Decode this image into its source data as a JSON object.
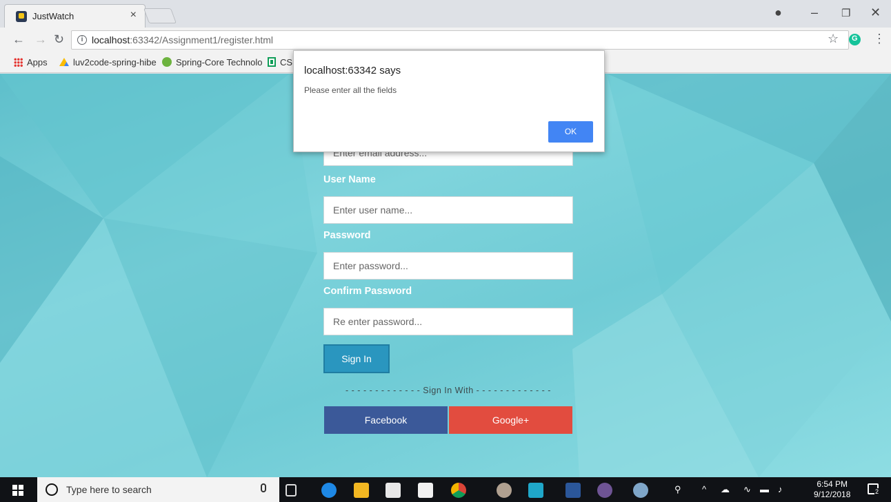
{
  "browser": {
    "tab_title": "JustWatch",
    "tab_close": "×",
    "url_host": "localhost",
    "url_rest": ":63342/Assignment1/register.html",
    "bookmarks": [
      {
        "label": "Apps"
      },
      {
        "label": "luv2code-spring-hibe"
      },
      {
        "label": "Spring-Core Technolo"
      },
      {
        "label": "CS"
      }
    ]
  },
  "form": {
    "email_placeholder": "Enter email address...",
    "username_label": "User Name",
    "username_placeholder": "Enter user name...",
    "password_label": "Password",
    "password_placeholder": "Enter password...",
    "confirm_label": "Confirm Password",
    "confirm_placeholder": "Re enter password...",
    "signin_label": "Sign In",
    "divider": "- - - - - - - - - - - - - Sign In With - - - - - - - - - - - - -",
    "facebook_label": "Facebook",
    "google_label": "Google+"
  },
  "dialog": {
    "title": "localhost:63342 says",
    "message": "Please enter all the fields",
    "ok_label": "OK"
  },
  "taskbar": {
    "search_placeholder": "Type here to search",
    "time": "6:54 PM",
    "date": "9/12/2018",
    "notification_count": "2"
  },
  "colors": {
    "accent_button": "#2a96bf",
    "facebook": "#3b5999",
    "google": "#e24c3f",
    "dialog_ok": "#4285f4"
  }
}
